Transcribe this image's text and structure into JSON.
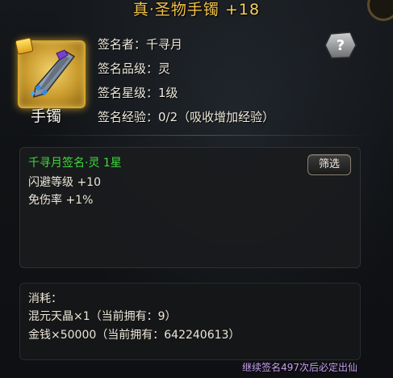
{
  "title": {
    "name": "真·圣物手镯",
    "plus": "+18"
  },
  "item": {
    "name": "手镯",
    "icon": "bracelet-icon",
    "badge": "lock-badge"
  },
  "info": [
    {
      "label": "签名者：千寻月"
    },
    {
      "label": "签名品级：灵"
    },
    {
      "label": "签名星级：1级"
    },
    {
      "label": "签名经验：0/2（吸收增加经验）"
    }
  ],
  "help": {
    "symbol": "?"
  },
  "signature_box": {
    "header": "千寻月签名·灵 1星",
    "filter_label": "筛选",
    "stats": [
      "闪避等级 +10",
      "免伤率 +1%"
    ]
  },
  "cost": {
    "header": "消耗：",
    "lines": [
      "混元天晶×1（当前拥有：9）",
      "金钱×50000（当前拥有：642240613）"
    ]
  },
  "footer": "继续签名497次后必定出仙",
  "colors": {
    "gold": "#f3c24a",
    "green": "#3fdc3f",
    "purple": "#c8a2f0"
  }
}
